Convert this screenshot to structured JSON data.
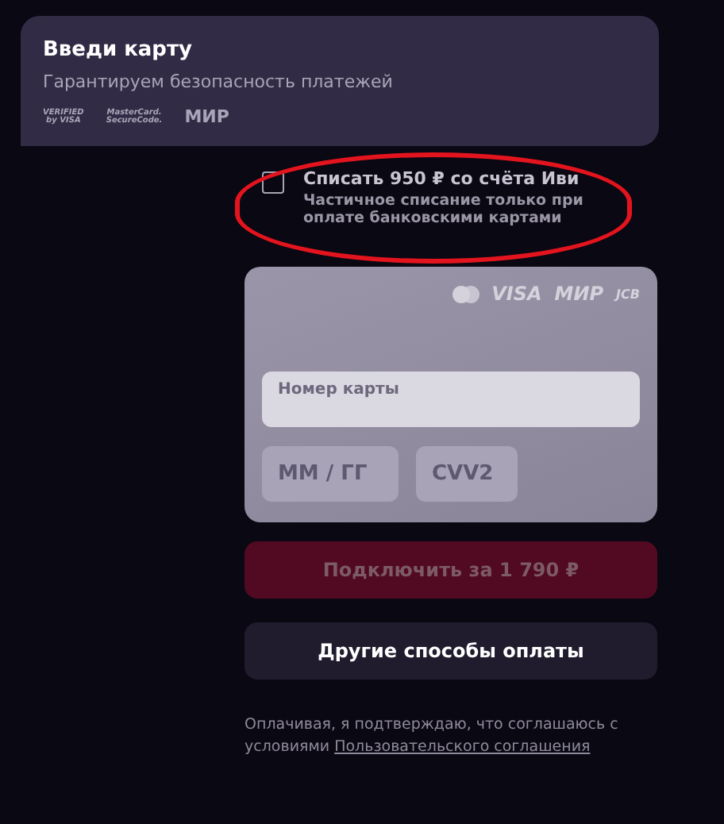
{
  "header": {
    "title": "Введи карту",
    "subtitle": "Гарантируем безопасность платежей",
    "security_logos": [
      {
        "top": "VERIFIED",
        "bottom": "by VISA"
      },
      {
        "top": "MasterCard.",
        "bottom": "SecureCode."
      },
      {
        "top": "МИР"
      }
    ]
  },
  "balance_option": {
    "checked": false,
    "title": "Списать 950 ₽ со счёта Иви",
    "note": "Частичное списание только при оплате банковскими картами",
    "highlighted": true
  },
  "card_form": {
    "brands": [
      "VISA",
      "МИР",
      "JCB"
    ],
    "number": {
      "placeholder": "Номер карты"
    },
    "expiry": {
      "placeholder": "ММ / ГГ"
    },
    "cvv": {
      "placeholder": "CVV2"
    }
  },
  "buttons": [
    {
      "label": "Подключить за 1 790 ₽",
      "kind": "primary",
      "disabled": true
    },
    {
      "label": "Другие способы оплаты",
      "kind": "secondary",
      "disabled": false
    }
  ],
  "agreement": {
    "text": "Оплачивая, я подтверждаю, что соглашаюсь с условиями",
    "link": "Пользовательского соглашения"
  }
}
